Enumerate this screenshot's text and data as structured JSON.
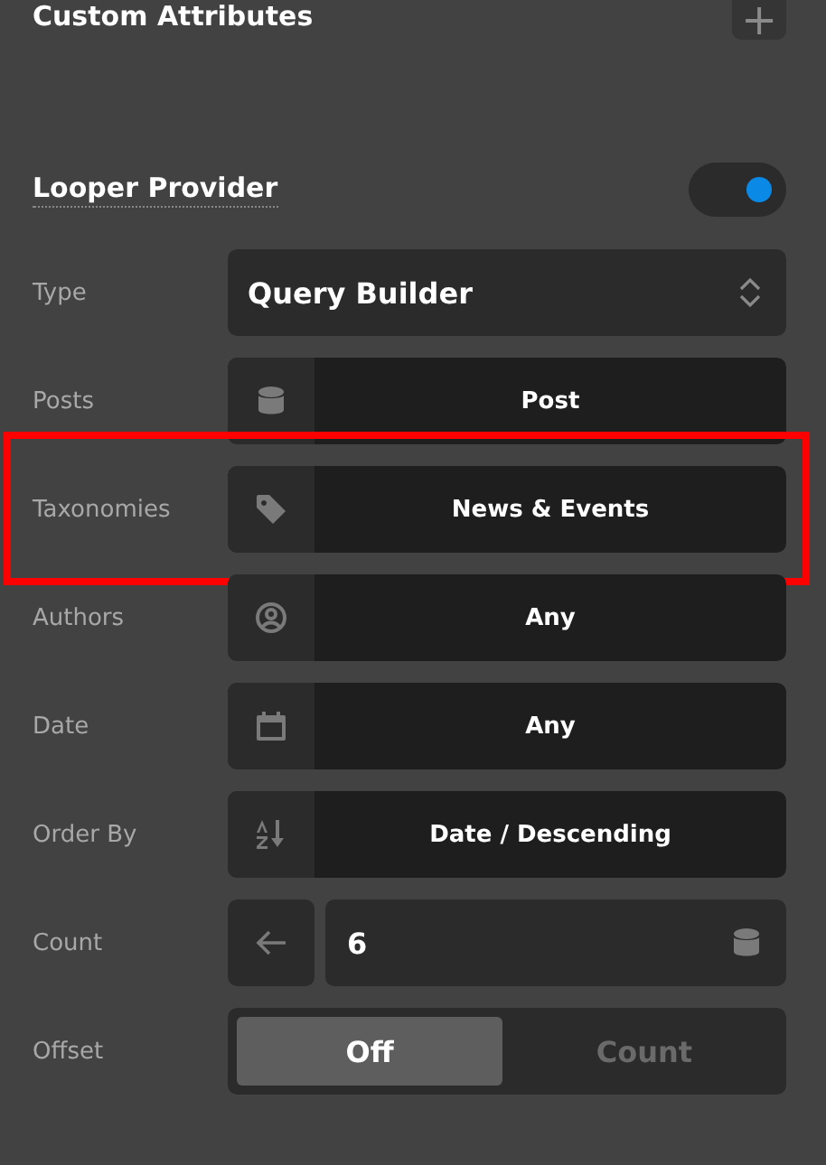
{
  "custom_attributes": {
    "title": "Custom Attributes",
    "add_label": "+"
  },
  "looper_provider": {
    "title": "Looper Provider",
    "on": true
  },
  "rows": [
    {
      "kind": "select",
      "label": "Type",
      "value": "Query Builder",
      "highlighted": false
    },
    {
      "kind": "picker",
      "label": "Posts",
      "value": "Post",
      "highlighted": false
    },
    {
      "kind": "picker",
      "label": "Taxonomies",
      "value": "News & Events",
      "highlighted": true
    },
    {
      "kind": "picker",
      "label": "Authors",
      "value": "Any",
      "highlighted": false
    },
    {
      "kind": "picker",
      "label": "Date",
      "value": "Any",
      "highlighted": false
    },
    {
      "kind": "picker",
      "label": "Order By",
      "value": "Date / Descending",
      "highlighted": false
    },
    {
      "kind": "number",
      "label": "Count",
      "value": "6",
      "highlighted": false
    },
    {
      "kind": "segmented",
      "label": "Offset",
      "highlighted": false,
      "options": [
        {
          "label": "Off",
          "selected": true
        },
        {
          "label": "Count",
          "selected": false
        }
      ]
    }
  ]
}
